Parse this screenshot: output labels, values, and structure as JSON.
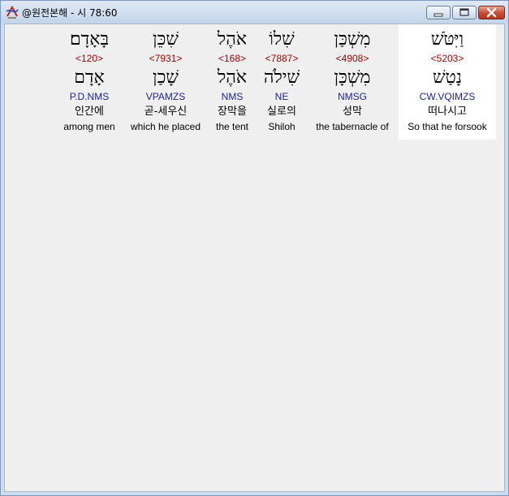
{
  "window": {
    "title": "@원전본해 - 시 78:60"
  },
  "words": [
    {
      "hebrew": "וַיִּטֹּשׁ",
      "strong": "<5203>",
      "lemma": "נָטַשׁ",
      "morph": "CW.VQIMZS",
      "korean": "떠나시고",
      "english": "So that he forsook"
    },
    {
      "hebrew": "מִשְׁכַּן",
      "strong": "<4908>",
      "lemma": "מִשְׁכָּן",
      "morph": "NMSG",
      "korean": "성막",
      "english": "the tabernacle of"
    },
    {
      "hebrew": "שִׁלוֹ",
      "strong": "<7887>",
      "lemma": "שִׁילֹה",
      "morph": "NE",
      "korean": "실로의",
      "english": "Shiloh"
    },
    {
      "hebrew": "אֹהֶל",
      "strong": "<168>",
      "lemma": "אֹהֶל",
      "morph": "NMS",
      "korean": "장막을",
      "english": "the tent"
    },
    {
      "hebrew": "שִׁכֵּן",
      "strong": "<7931>",
      "lemma": "שָׁכַן",
      "morph": "VPAMZS",
      "korean": "곧-세우신",
      "english": "which he placed"
    },
    {
      "hebrew": "בָּאָדָם׃",
      "strong": "<120>",
      "lemma": "אָדָם",
      "morph": "P.D.NMS",
      "korean": "인간에",
      "english": "among men"
    }
  ]
}
